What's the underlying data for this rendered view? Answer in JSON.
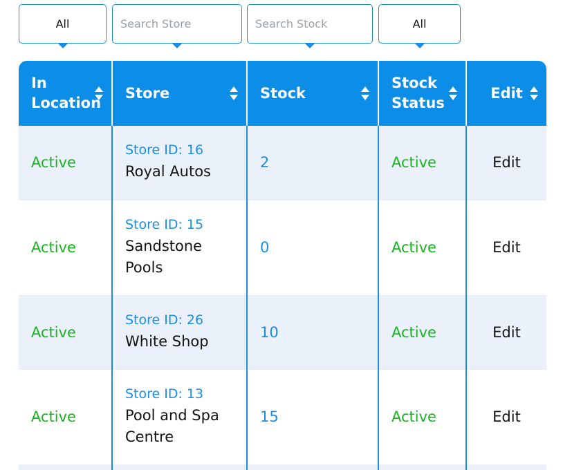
{
  "filters": {
    "in_location": "All",
    "store_placeholder": "Search Store",
    "stock_placeholder": "Search Stock",
    "stock_status": "All"
  },
  "headers": {
    "in_location": "In Location",
    "store": "Store",
    "stock": "Stock",
    "stock_status": "Stock Status",
    "edit": "Edit"
  },
  "rows": [
    {
      "in_location": "Active",
      "store_id": "Store ID: 16",
      "store_name": "Royal Autos",
      "stock": "2",
      "stock_status": "Active",
      "edit": "Edit"
    },
    {
      "in_location": "Active",
      "store_id": "Store ID: 15",
      "store_name": "Sandstone Pools",
      "stock": "0",
      "stock_status": "Active",
      "edit": "Edit"
    },
    {
      "in_location": "Active",
      "store_id": "Store ID: 26",
      "store_name": "White Shop",
      "stock": "10",
      "stock_status": "Active",
      "edit": "Edit"
    },
    {
      "in_location": "Active",
      "store_id": "Store ID: 13",
      "store_name": "Pool and Spa Centre",
      "stock": "15",
      "stock_status": "Active",
      "edit": "Edit"
    }
  ],
  "colors": {
    "accent": "#0b8de8",
    "active": "#19b31f",
    "row_alt": "#ebf1fb"
  },
  "icons": {
    "sort": "sort-arrows-icon",
    "dropdown": "caret-down-icon"
  }
}
